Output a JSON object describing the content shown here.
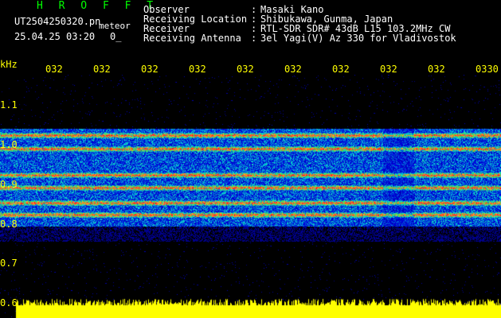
{
  "header": {
    "station_title": "H R O F F T",
    "filename": "UT2504250320.pn",
    "meteor_word": "meteor",
    "datetime": "25.04.25 03:20",
    "count": "0_"
  },
  "info": {
    "labels": [
      "Observer",
      "Receiving Location",
      "Receiver",
      "Receiving Antenna"
    ],
    "separators": [
      ":",
      ":",
      ":",
      ":"
    ],
    "values": [
      "Masaki Kano",
      "Shibukawa, Gunma, Japan",
      "RTL-SDR SDR# 43dB L15 103.2MHz CW",
      "3el Yagi(V) Az 330 for Vladivostok"
    ]
  },
  "axis": {
    "unit": "kHz",
    "time_ticks": [
      "032",
      "032",
      "032",
      "032",
      "032",
      "032",
      "032",
      "032",
      "032",
      "0330"
    ],
    "freq_ticks": [
      "1.1",
      "1.0",
      "0.9",
      "0.8",
      "0.7",
      "0.6"
    ]
  },
  "colors": {
    "text": "#ffffff",
    "title": "#00ff00",
    "axis": "#ffff00",
    "background": "#000000",
    "noise_floor": "#ffff00"
  }
}
